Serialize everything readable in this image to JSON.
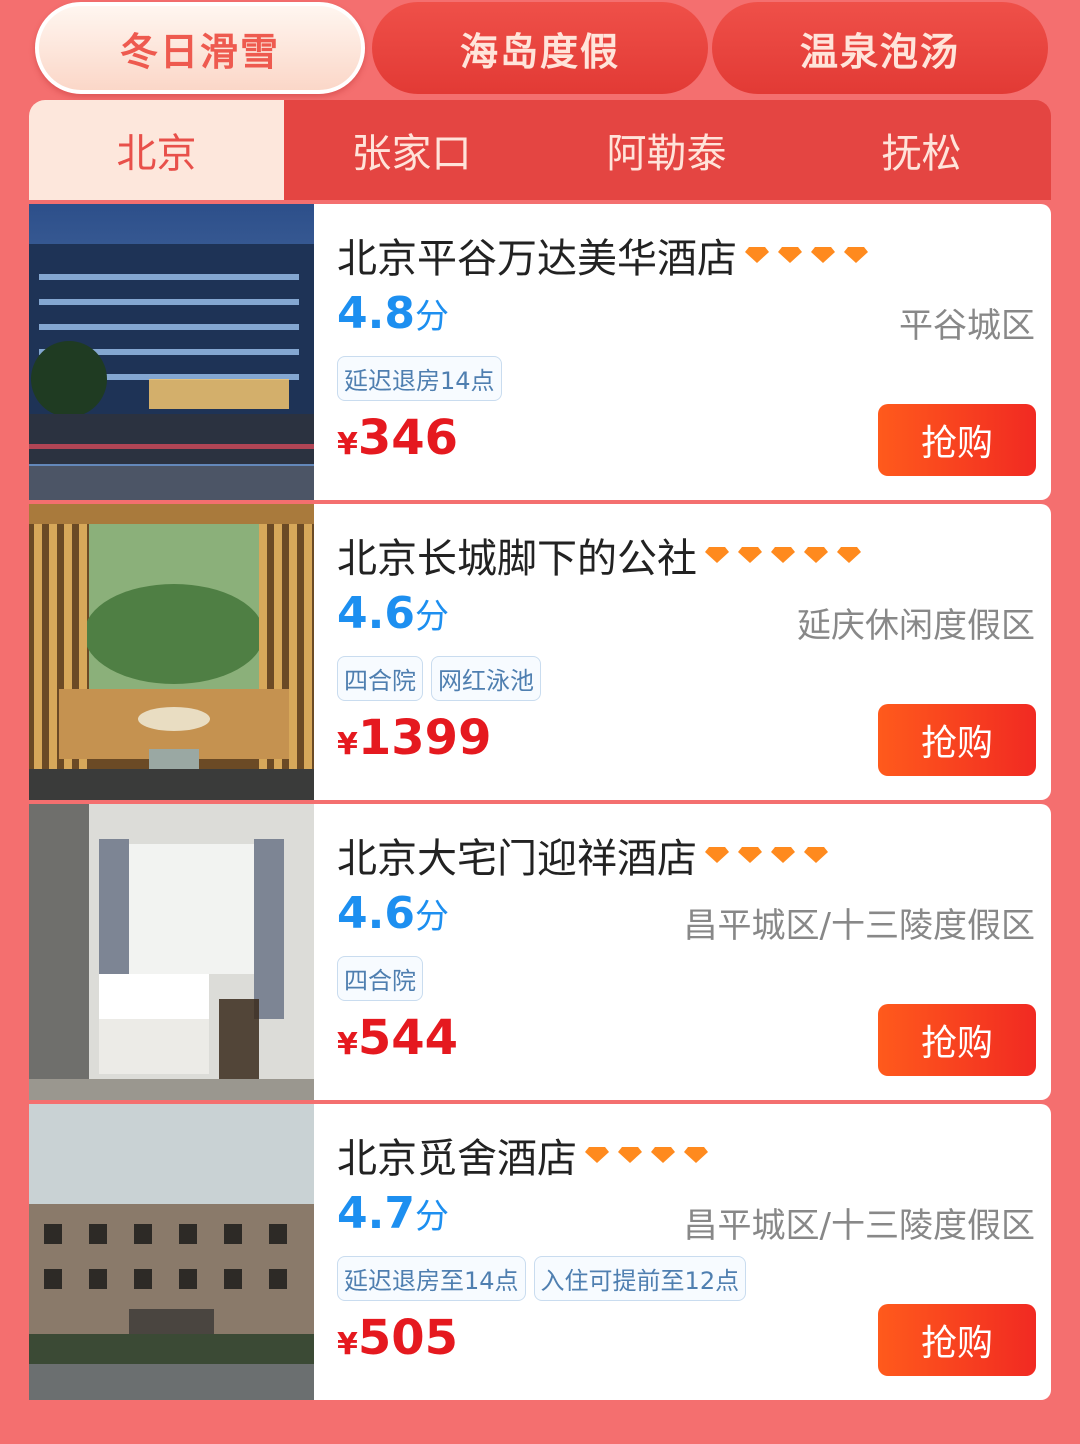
{
  "categories": [
    {
      "label": "冬日滑雪",
      "active": true
    },
    {
      "label": "海岛度假",
      "active": false
    },
    {
      "label": "温泉泡汤",
      "active": false
    }
  ],
  "cities": [
    {
      "label": "北京",
      "active": true
    },
    {
      "label": "张家口",
      "active": false
    },
    {
      "label": "阿勒泰",
      "active": false
    },
    {
      "label": "抚松",
      "active": false
    }
  ],
  "hotels": [
    {
      "name": "北京平谷万达美华酒店",
      "diamonds": 4,
      "score": "4.8",
      "score_unit": "分",
      "area": "平谷城区",
      "tags": [
        "延迟退房14点"
      ],
      "currency": "¥",
      "price": "346",
      "buy_label": "抢购"
    },
    {
      "name": "北京长城脚下的公社",
      "diamonds": 5,
      "score": "4.6",
      "score_unit": "分",
      "area": "延庆休闲度假区",
      "tags": [
        "四合院",
        "网红泳池"
      ],
      "currency": "¥",
      "price": "1399",
      "buy_label": "抢购"
    },
    {
      "name": "北京大宅门迎祥酒店",
      "diamonds": 4,
      "score": "4.6",
      "score_unit": "分",
      "area": "昌平城区/十三陵度假区",
      "tags": [
        "四合院"
      ],
      "currency": "¥",
      "price": "544",
      "buy_label": "抢购"
    },
    {
      "name": "北京觅舍酒店",
      "diamonds": 4,
      "score": "4.7",
      "score_unit": "分",
      "area": "昌平城区/十三陵度假区",
      "tags": [
        "延迟退房至14点",
        "入住可提前至12点"
      ],
      "currency": "¥",
      "price": "505",
      "buy_label": "抢购"
    }
  ],
  "colors": {
    "background": "#f46f6f",
    "tab_red": "#e44542",
    "score_blue": "#1d8ff0",
    "price_red": "#e5191f",
    "diamond_orange": "#ff8a1e"
  }
}
